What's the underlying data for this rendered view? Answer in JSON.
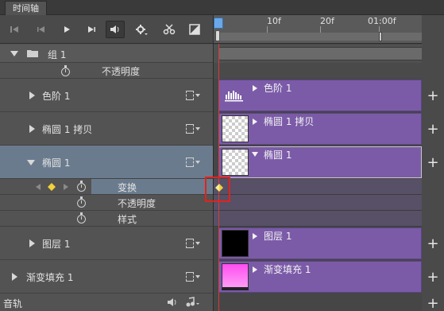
{
  "panel": {
    "tab_label": "时间轴"
  },
  "ruler": {
    "labels": [
      "10f",
      "20f",
      "01:00f"
    ]
  },
  "layers": [
    {
      "name": "组 1",
      "props": [
        {
          "label": "不透明度"
        }
      ]
    },
    {
      "name": "色阶 1",
      "clip_label": "色阶 1"
    },
    {
      "name": "椭圆 1 拷贝",
      "clip_label": "椭圆 1 拷贝"
    },
    {
      "name": "椭圆 1",
      "clip_label": "椭圆 1",
      "props": [
        {
          "label": "变换"
        },
        {
          "label": "不透明度"
        },
        {
          "label": "样式"
        }
      ]
    },
    {
      "name": "图层 1",
      "clip_label": "图层 1"
    },
    {
      "name": "渐变填充 1",
      "clip_label": "渐变填充 1"
    }
  ],
  "audio": {
    "label": "音轨"
  },
  "colors": {
    "clip": "#7b5ba8",
    "playhead": "#d93a3a",
    "keyframe": "#f0d23a",
    "highlight_box": "#e2231a"
  }
}
